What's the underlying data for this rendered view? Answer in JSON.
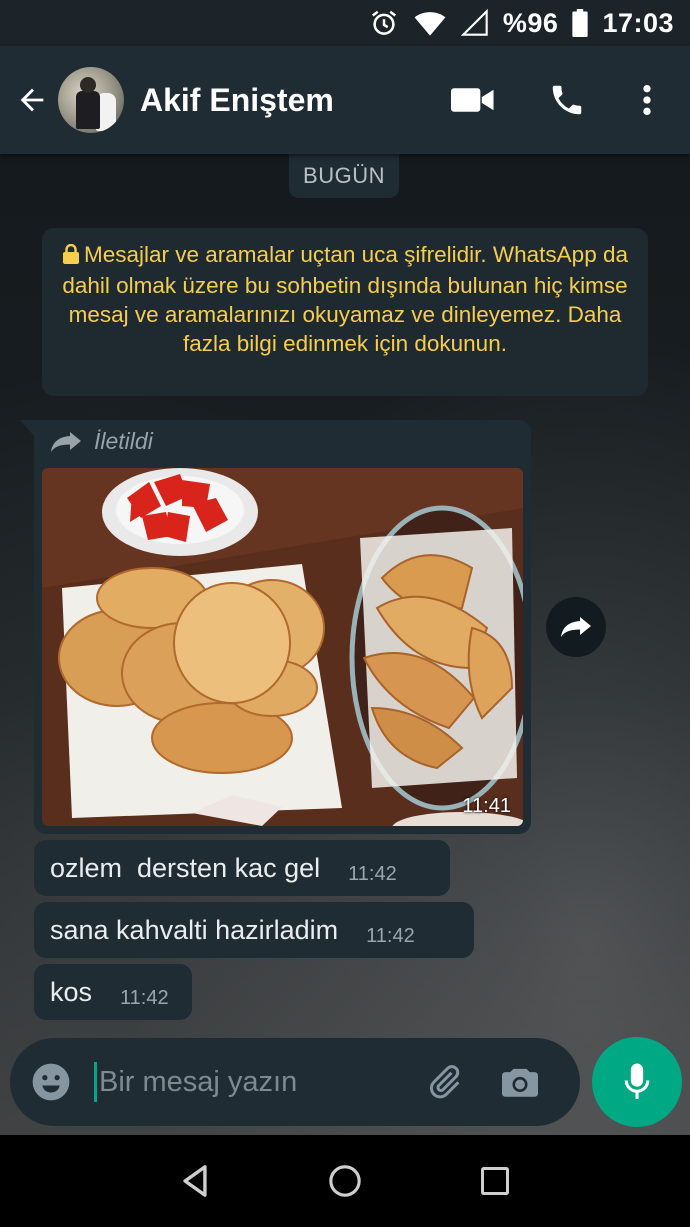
{
  "status_bar": {
    "battery_percent": "%96",
    "time": "17:03",
    "icons": [
      "alarm-icon",
      "wifi-icon",
      "cell-signal-icon",
      "battery-icon"
    ]
  },
  "header": {
    "contact_name": "Akif Eniştem",
    "icons": [
      "back-arrow-icon",
      "video-call-icon",
      "phone-icon",
      "more-vertical-icon"
    ]
  },
  "chat": {
    "date_chip": "BUGÜN",
    "encryption_notice": "Mesajlar ve aramalar uçtan uca şifrelidir. WhatsApp da dahil olmak üzere bu sohbetin dışında bulunan hiç kimse mesaj ve aramalarınızı okuyamaz ve dinleyemez. Daha fazla bilgi edinmek için dokunun.",
    "image_message": {
      "forwarded_label": "İletildi",
      "time": "11:41"
    },
    "messages": [
      {
        "text": "ozlem  dersten kac gel",
        "time": "11:42"
      },
      {
        "text": "sana kahvalti hazirladim",
        "time": "11:42"
      },
      {
        "text": "kos",
        "time": "11:42"
      }
    ]
  },
  "composer": {
    "placeholder": "Bir mesaj yazın",
    "icons": [
      "emoji-icon",
      "attach-icon",
      "camera-icon",
      "mic-icon"
    ]
  },
  "navbar": {
    "icons": [
      "nav-back-icon",
      "nav-home-icon",
      "nav-recents-icon"
    ]
  },
  "colors": {
    "accent": "#00a884",
    "header_bg": "#1f2c34",
    "bubble_bg": "#1f2c34",
    "notice_text": "#f7cd4e"
  }
}
